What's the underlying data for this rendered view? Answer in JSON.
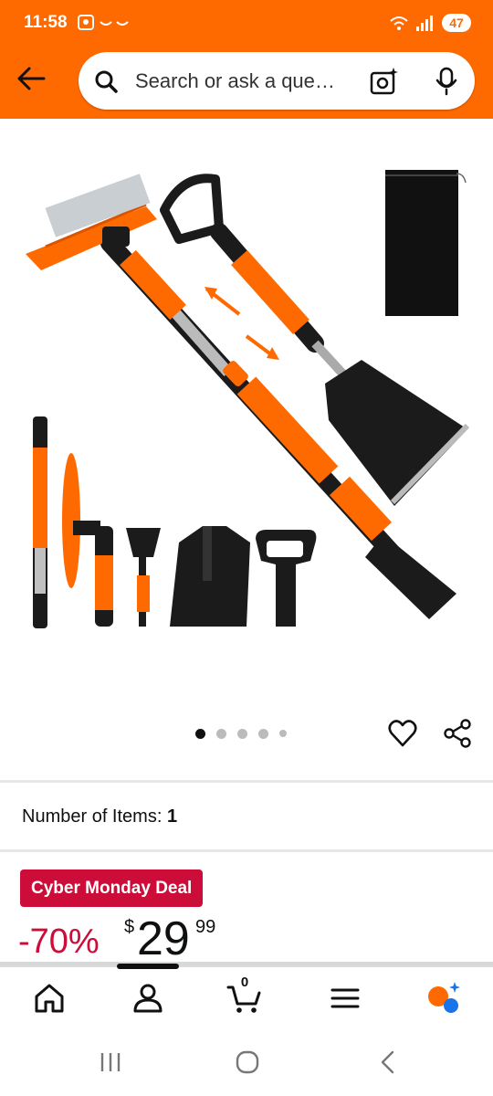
{
  "status_bar": {
    "time": "11:58",
    "battery": "47"
  },
  "header": {
    "search_placeholder": "Search or ask a que…",
    "accent_color": "#ff6a00"
  },
  "product": {
    "image_count": 5,
    "active_image": 1,
    "number_of_items_label": "Number of Items:",
    "number_of_items_value": "1"
  },
  "deal": {
    "badge": "Cyber Monday Deal",
    "discount": "-70%",
    "currency": "$",
    "price_whole": "29",
    "price_fraction": "99",
    "badge_color": "#cc0c39"
  },
  "bottom_nav": {
    "cart_count": "0",
    "items": [
      "home-icon",
      "account-icon",
      "cart-icon",
      "menu-icon",
      "rufus-icon"
    ]
  }
}
